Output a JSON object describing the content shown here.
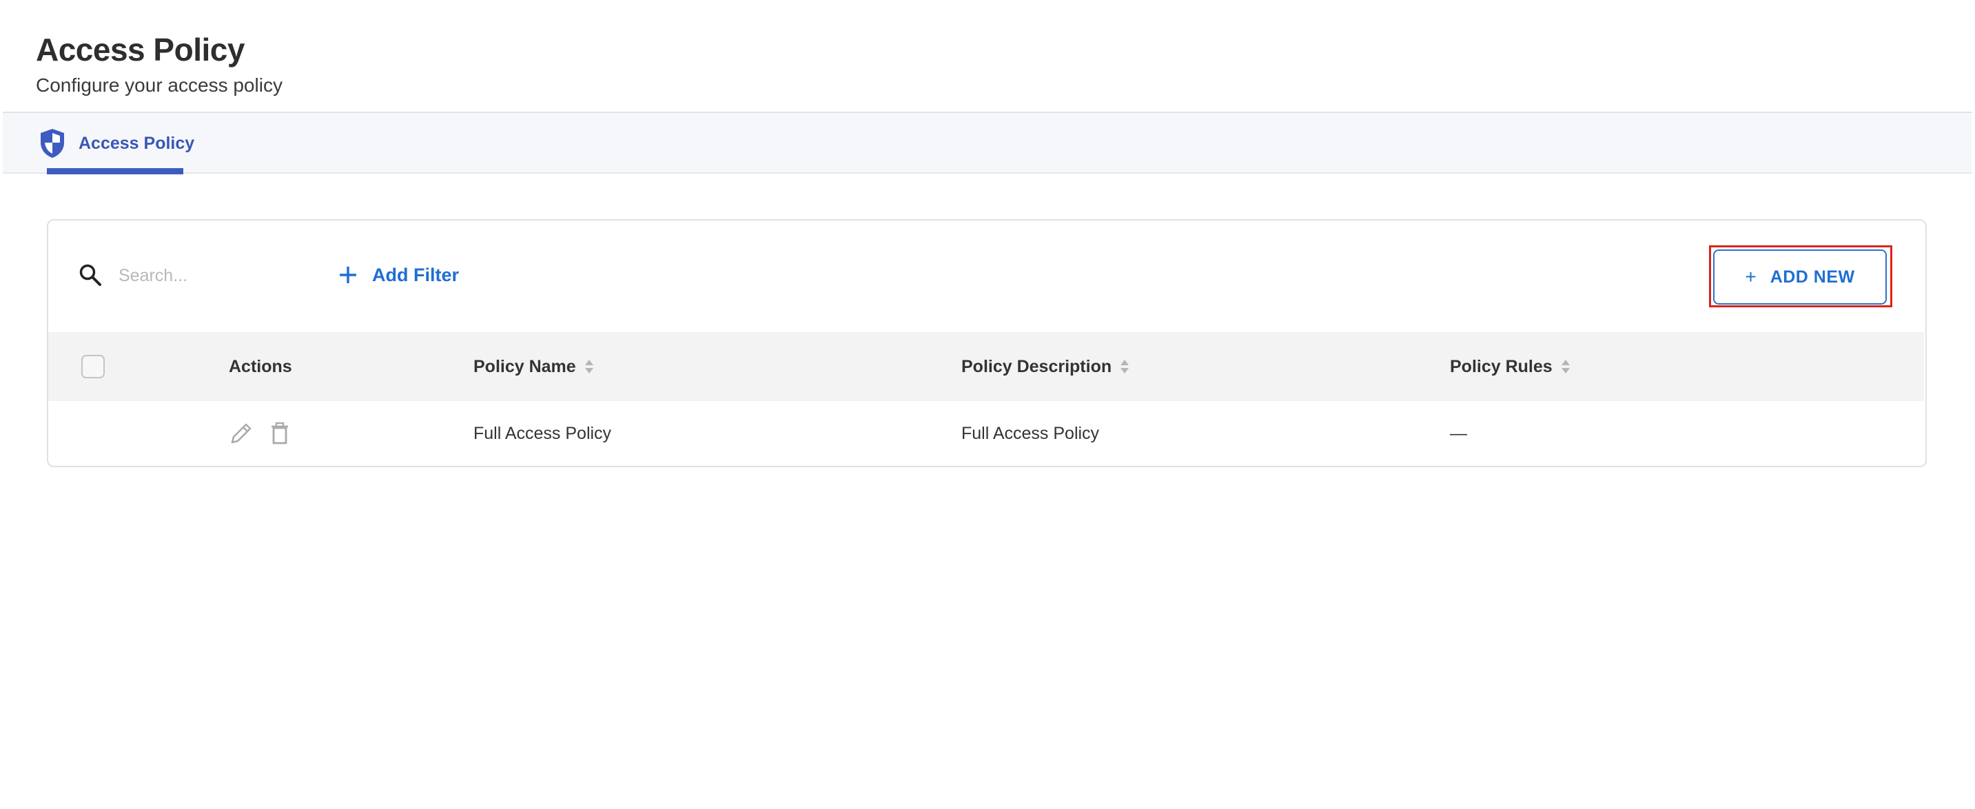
{
  "header": {
    "title": "Access Policy",
    "subtitle": "Configure your access policy"
  },
  "tabs": [
    {
      "label": "Access Policy",
      "icon": "shield-icon",
      "active": true
    }
  ],
  "toolbar": {
    "search_placeholder": "Search...",
    "add_filter_label": "Add Filter",
    "add_new_label": "ADD NEW",
    "add_new_plus": "+"
  },
  "table": {
    "columns": [
      "Actions",
      "Policy Name",
      "Policy Description",
      "Policy Rules"
    ],
    "rows": [
      {
        "policy_name": "Full Access Policy",
        "policy_description": "Full Access Policy",
        "policy_rules": "—",
        "actions": [
          "edit-icon",
          "delete-icon"
        ]
      }
    ]
  },
  "colors": {
    "accent": "#1f6ed4",
    "tab_accent": "#3d5bc0",
    "highlight": "#d9261c"
  }
}
